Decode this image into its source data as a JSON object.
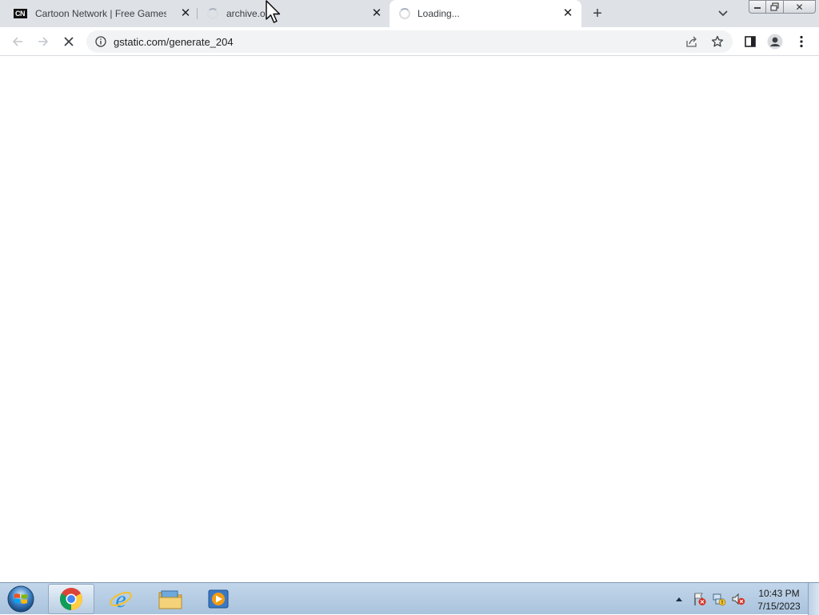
{
  "tabs": [
    {
      "title": "Cartoon Network | Free Games, C",
      "favicon": "cartoon-network-logo",
      "logo_text": "CN",
      "state": "loaded",
      "active": false
    },
    {
      "title": "archive.org",
      "favicon": "loading-spinner",
      "state": "loading",
      "active": false
    },
    {
      "title": "Loading...",
      "favicon": "loading-spinner",
      "state": "loading",
      "active": true
    }
  ],
  "tabstrip": {
    "new_tab_icon": "plus-icon",
    "tab_search_icon": "chevron-down-icon",
    "window_buttons": [
      "minimize",
      "restore",
      "close"
    ]
  },
  "toolbar": {
    "back_icon": "back-arrow-icon",
    "forward_icon": "forward-arrow-icon",
    "reload_icon": "stop-loading-x-icon",
    "site_info_icon": "info-circle-icon",
    "url": "gstatic.com/generate_204",
    "share_icon": "share-icon",
    "bookmark_icon": "star-icon",
    "side_panel_icon": "side-panel-icon",
    "profile_icon": "profile-avatar-icon",
    "menu_icon": "kebab-menu-icon"
  },
  "taskbar": {
    "start_icon": "windows-start-orb",
    "apps": [
      {
        "name": "chrome",
        "icon": "chrome-icon",
        "active": true
      },
      {
        "name": "internet-explorer",
        "icon": "ie-icon",
        "active": false
      },
      {
        "name": "file-explorer",
        "icon": "folder-icon",
        "active": false
      },
      {
        "name": "media-player",
        "icon": "media-player-icon",
        "active": false
      }
    ],
    "tray_icons": [
      "flag-error-icon",
      "network-error-icon",
      "volume-muted-icon"
    ],
    "time": "10:43 PM",
    "date": "7/15/2023"
  },
  "colors": {
    "tabstrip_bg": "#dee1e6",
    "omnibox_bg": "#f1f3f4",
    "taskbar_bg": "#b7cde3"
  }
}
